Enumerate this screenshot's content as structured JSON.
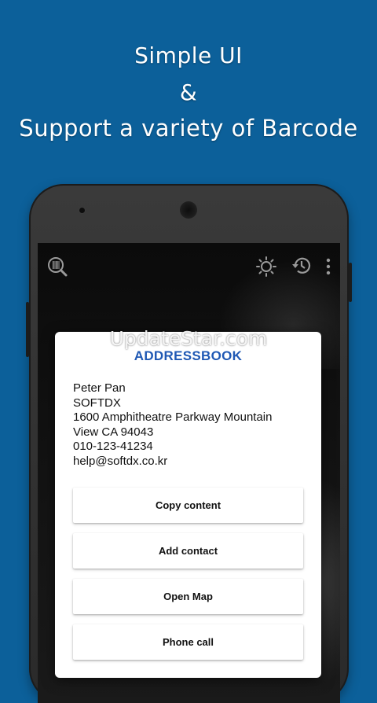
{
  "headline": {
    "line1": "Simple UI",
    "line2": "&",
    "line3": "Support a variety of Barcode"
  },
  "watermark": "UpdateStar.com",
  "toolbar": {
    "icons": [
      "barcode-search-icon",
      "flashlight-icon",
      "history-icon",
      "more-vert-icon"
    ]
  },
  "dialog": {
    "title": "ADDRESSBOOK",
    "contact_lines": [
      "Peter Pan",
      "SOFTDX",
      "1600 Amphitheatre Parkway Mountain",
      "View CA 94043",
      "010-123-41234",
      "help@softdx.co.kr"
    ],
    "buttons": [
      "Copy content",
      "Add contact",
      "Open Map",
      "Phone call"
    ]
  },
  "colors": {
    "background": "#0c609a",
    "title_accent": "#1f58b4"
  }
}
